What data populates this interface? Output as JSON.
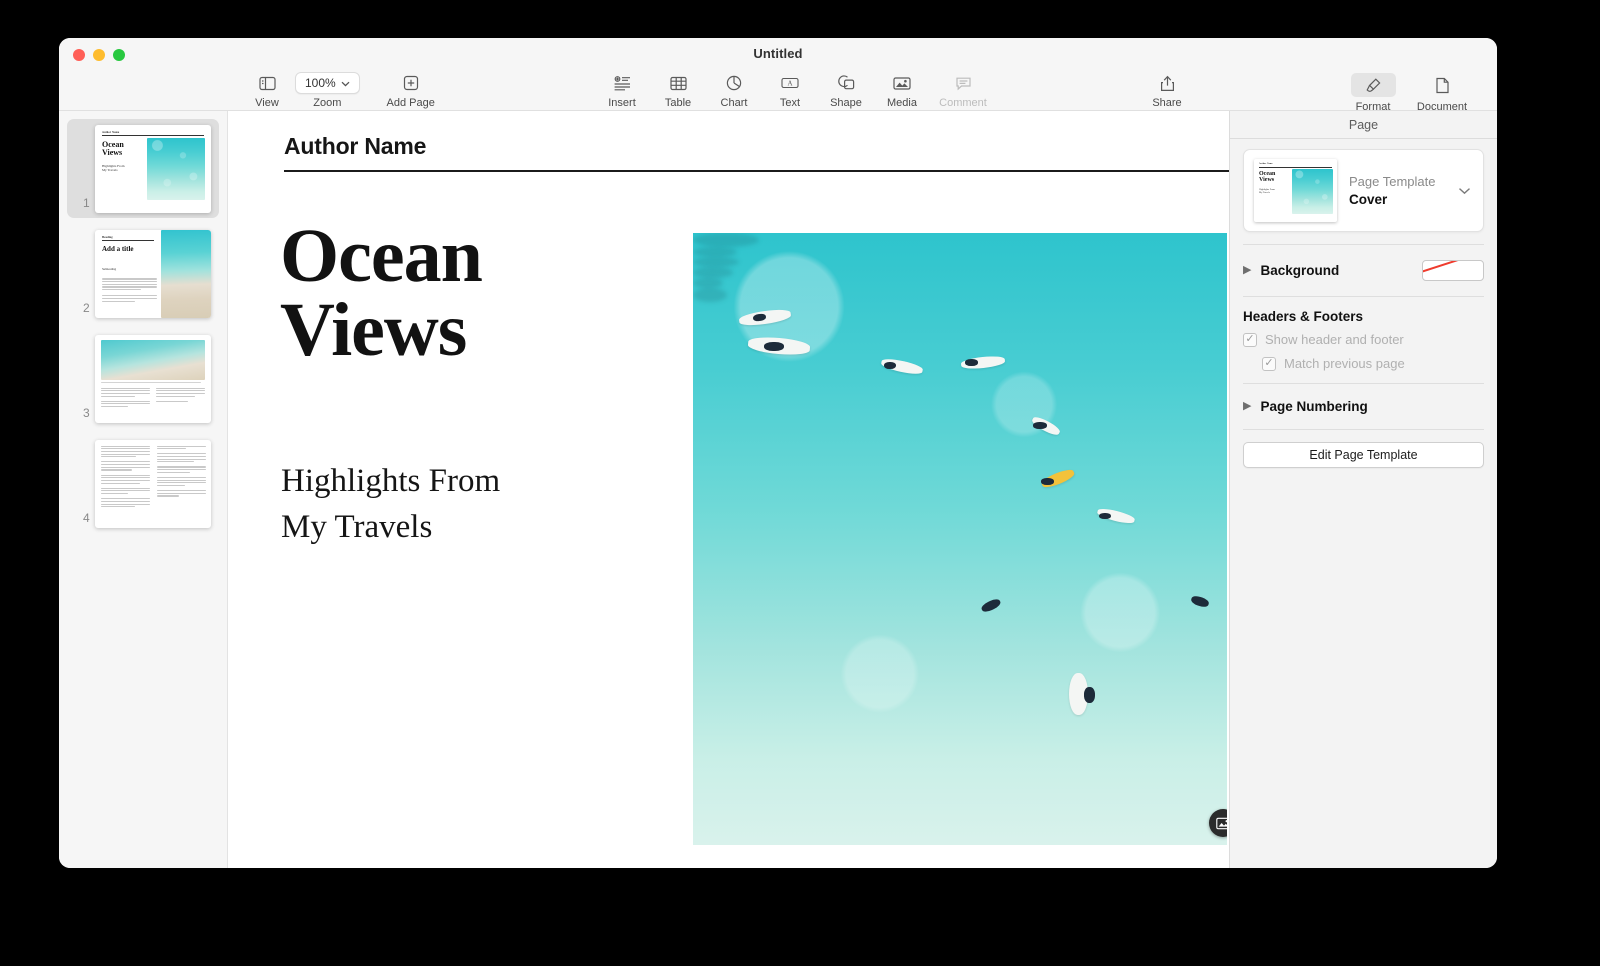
{
  "window": {
    "title": "Untitled",
    "traffic_lights": [
      "close",
      "minimize",
      "zoom"
    ]
  },
  "toolbar": {
    "view_label": "View",
    "zoom_value": "100%",
    "zoom_label": "Zoom",
    "add_page_label": "Add Page",
    "insert_label": "Insert",
    "table_label": "Table",
    "chart_label": "Chart",
    "text_label": "Text",
    "shape_label": "Shape",
    "media_label": "Media",
    "comment_label": "Comment",
    "share_label": "Share",
    "format_label": "Format",
    "document_label": "Document"
  },
  "thumbnails": {
    "pages": [
      {
        "number": "1",
        "selected": true,
        "kind": "cover",
        "eyebrow": "Author Name",
        "title_line1": "Ocean",
        "title_line2": "Views",
        "sub_line1": "Highlights From",
        "sub_line2": "My Travels"
      },
      {
        "number": "2",
        "selected": false,
        "kind": "title-body",
        "eyebrow": "Heading",
        "title": "Add a title",
        "subheading": "Subheading"
      },
      {
        "number": "3",
        "selected": false,
        "kind": "photo-top",
        "caption": "Caption text"
      },
      {
        "number": "4",
        "selected": false,
        "kind": "two-column"
      }
    ]
  },
  "document": {
    "eyebrow": "Author Name",
    "title_line1": "Ocean",
    "title_line2": "Views",
    "subtitle_line1": "Highlights From",
    "subtitle_line2": "My Travels",
    "photo_alt": "aerial ocean with surfers",
    "media_badge_icon": "image-placeholder-icon"
  },
  "inspector": {
    "header": "Page",
    "page_template": {
      "label": "Page Template",
      "value": "Cover"
    },
    "background": {
      "label": "Background",
      "fill": "none"
    },
    "headers_footers": {
      "title": "Headers & Footers",
      "show_header_footer": {
        "label": "Show header and footer",
        "checked": true,
        "enabled": false
      },
      "match_previous_page": {
        "label": "Match previous page",
        "checked": true,
        "enabled": false
      }
    },
    "page_numbering": {
      "label": "Page Numbering"
    },
    "edit_page_template_label": "Edit Page Template"
  },
  "colors": {
    "ocean_deep": "#2ec4cd",
    "ocean_mid": "#6fd9d7",
    "ocean_shallow": "#d9f2ec",
    "sand": "#ded3bf",
    "accent_red": "#ef3b2d",
    "selection_gray": "#dedede"
  }
}
